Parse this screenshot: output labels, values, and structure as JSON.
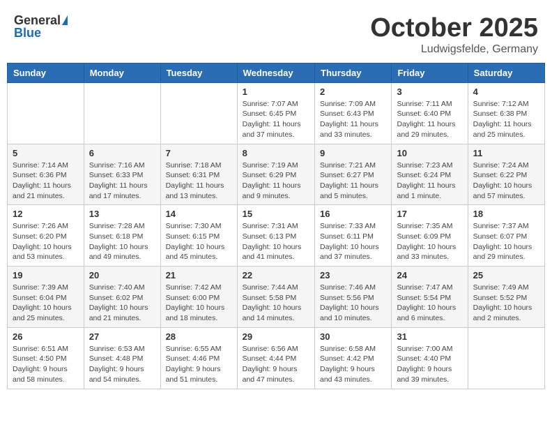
{
  "header": {
    "logo_general": "General",
    "logo_blue": "Blue",
    "month": "October 2025",
    "location": "Ludwigsfelde, Germany"
  },
  "days_of_week": [
    "Sunday",
    "Monday",
    "Tuesday",
    "Wednesday",
    "Thursday",
    "Friday",
    "Saturday"
  ],
  "weeks": [
    [
      {
        "day": "",
        "sunrise": "",
        "sunset": "",
        "daylight": ""
      },
      {
        "day": "",
        "sunrise": "",
        "sunset": "",
        "daylight": ""
      },
      {
        "day": "",
        "sunrise": "",
        "sunset": "",
        "daylight": ""
      },
      {
        "day": "1",
        "sunrise": "Sunrise: 7:07 AM",
        "sunset": "Sunset: 6:45 PM",
        "daylight": "Daylight: 11 hours and 37 minutes."
      },
      {
        "day": "2",
        "sunrise": "Sunrise: 7:09 AM",
        "sunset": "Sunset: 6:43 PM",
        "daylight": "Daylight: 11 hours and 33 minutes."
      },
      {
        "day": "3",
        "sunrise": "Sunrise: 7:11 AM",
        "sunset": "Sunset: 6:40 PM",
        "daylight": "Daylight: 11 hours and 29 minutes."
      },
      {
        "day": "4",
        "sunrise": "Sunrise: 7:12 AM",
        "sunset": "Sunset: 6:38 PM",
        "daylight": "Daylight: 11 hours and 25 minutes."
      }
    ],
    [
      {
        "day": "5",
        "sunrise": "Sunrise: 7:14 AM",
        "sunset": "Sunset: 6:36 PM",
        "daylight": "Daylight: 11 hours and 21 minutes."
      },
      {
        "day": "6",
        "sunrise": "Sunrise: 7:16 AM",
        "sunset": "Sunset: 6:33 PM",
        "daylight": "Daylight: 11 hours and 17 minutes."
      },
      {
        "day": "7",
        "sunrise": "Sunrise: 7:18 AM",
        "sunset": "Sunset: 6:31 PM",
        "daylight": "Daylight: 11 hours and 13 minutes."
      },
      {
        "day": "8",
        "sunrise": "Sunrise: 7:19 AM",
        "sunset": "Sunset: 6:29 PM",
        "daylight": "Daylight: 11 hours and 9 minutes."
      },
      {
        "day": "9",
        "sunrise": "Sunrise: 7:21 AM",
        "sunset": "Sunset: 6:27 PM",
        "daylight": "Daylight: 11 hours and 5 minutes."
      },
      {
        "day": "10",
        "sunrise": "Sunrise: 7:23 AM",
        "sunset": "Sunset: 6:24 PM",
        "daylight": "Daylight: 11 hours and 1 minute."
      },
      {
        "day": "11",
        "sunrise": "Sunrise: 7:24 AM",
        "sunset": "Sunset: 6:22 PM",
        "daylight": "Daylight: 10 hours and 57 minutes."
      }
    ],
    [
      {
        "day": "12",
        "sunrise": "Sunrise: 7:26 AM",
        "sunset": "Sunset: 6:20 PM",
        "daylight": "Daylight: 10 hours and 53 minutes."
      },
      {
        "day": "13",
        "sunrise": "Sunrise: 7:28 AM",
        "sunset": "Sunset: 6:18 PM",
        "daylight": "Daylight: 10 hours and 49 minutes."
      },
      {
        "day": "14",
        "sunrise": "Sunrise: 7:30 AM",
        "sunset": "Sunset: 6:15 PM",
        "daylight": "Daylight: 10 hours and 45 minutes."
      },
      {
        "day": "15",
        "sunrise": "Sunrise: 7:31 AM",
        "sunset": "Sunset: 6:13 PM",
        "daylight": "Daylight: 10 hours and 41 minutes."
      },
      {
        "day": "16",
        "sunrise": "Sunrise: 7:33 AM",
        "sunset": "Sunset: 6:11 PM",
        "daylight": "Daylight: 10 hours and 37 minutes."
      },
      {
        "day": "17",
        "sunrise": "Sunrise: 7:35 AM",
        "sunset": "Sunset: 6:09 PM",
        "daylight": "Daylight: 10 hours and 33 minutes."
      },
      {
        "day": "18",
        "sunrise": "Sunrise: 7:37 AM",
        "sunset": "Sunset: 6:07 PM",
        "daylight": "Daylight: 10 hours and 29 minutes."
      }
    ],
    [
      {
        "day": "19",
        "sunrise": "Sunrise: 7:39 AM",
        "sunset": "Sunset: 6:04 PM",
        "daylight": "Daylight: 10 hours and 25 minutes."
      },
      {
        "day": "20",
        "sunrise": "Sunrise: 7:40 AM",
        "sunset": "Sunset: 6:02 PM",
        "daylight": "Daylight: 10 hours and 21 minutes."
      },
      {
        "day": "21",
        "sunrise": "Sunrise: 7:42 AM",
        "sunset": "Sunset: 6:00 PM",
        "daylight": "Daylight: 10 hours and 18 minutes."
      },
      {
        "day": "22",
        "sunrise": "Sunrise: 7:44 AM",
        "sunset": "Sunset: 5:58 PM",
        "daylight": "Daylight: 10 hours and 14 minutes."
      },
      {
        "day": "23",
        "sunrise": "Sunrise: 7:46 AM",
        "sunset": "Sunset: 5:56 PM",
        "daylight": "Daylight: 10 hours and 10 minutes."
      },
      {
        "day": "24",
        "sunrise": "Sunrise: 7:47 AM",
        "sunset": "Sunset: 5:54 PM",
        "daylight": "Daylight: 10 hours and 6 minutes."
      },
      {
        "day": "25",
        "sunrise": "Sunrise: 7:49 AM",
        "sunset": "Sunset: 5:52 PM",
        "daylight": "Daylight: 10 hours and 2 minutes."
      }
    ],
    [
      {
        "day": "26",
        "sunrise": "Sunrise: 6:51 AM",
        "sunset": "Sunset: 4:50 PM",
        "daylight": "Daylight: 9 hours and 58 minutes."
      },
      {
        "day": "27",
        "sunrise": "Sunrise: 6:53 AM",
        "sunset": "Sunset: 4:48 PM",
        "daylight": "Daylight: 9 hours and 54 minutes."
      },
      {
        "day": "28",
        "sunrise": "Sunrise: 6:55 AM",
        "sunset": "Sunset: 4:46 PM",
        "daylight": "Daylight: 9 hours and 51 minutes."
      },
      {
        "day": "29",
        "sunrise": "Sunrise: 6:56 AM",
        "sunset": "Sunset: 4:44 PM",
        "daylight": "Daylight: 9 hours and 47 minutes."
      },
      {
        "day": "30",
        "sunrise": "Sunrise: 6:58 AM",
        "sunset": "Sunset: 4:42 PM",
        "daylight": "Daylight: 9 hours and 43 minutes."
      },
      {
        "day": "31",
        "sunrise": "Sunrise: 7:00 AM",
        "sunset": "Sunset: 4:40 PM",
        "daylight": "Daylight: 9 hours and 39 minutes."
      },
      {
        "day": "",
        "sunrise": "",
        "sunset": "",
        "daylight": ""
      }
    ]
  ]
}
